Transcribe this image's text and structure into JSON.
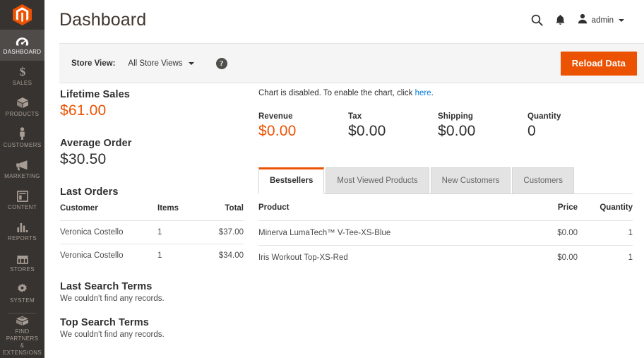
{
  "colors": {
    "accent_orange": "#eb5202",
    "sidebar_bg": "#373330",
    "sidebar_active_bg": "#4f4b48",
    "link_blue": "#007bdb",
    "panel_bg": "#f5f5f5"
  },
  "sidebar": {
    "logo_name": "magento-logo",
    "items": [
      {
        "label": "DASHBOARD",
        "icon": "dashboard-gauge-icon",
        "active": true
      },
      {
        "label": "SALES",
        "icon": "dollar-sign-icon",
        "active": false
      },
      {
        "label": "PRODUCTS",
        "icon": "box-icon",
        "active": false
      },
      {
        "label": "CUSTOMERS",
        "icon": "person-icon",
        "active": false
      },
      {
        "label": "MARKETING",
        "icon": "megaphone-icon",
        "active": false
      },
      {
        "label": "CONTENT",
        "icon": "layout-panel-icon",
        "active": false
      },
      {
        "label": "REPORTS",
        "icon": "bar-chart-icon",
        "active": false
      },
      {
        "label": "STORES",
        "icon": "storefront-icon",
        "active": false
      },
      {
        "label": "SYSTEM",
        "icon": "gear-icon",
        "active": false
      },
      {
        "label": "FIND PARTNERS\n& EXTENSIONS",
        "icon": "open-box-icon",
        "active": false
      }
    ],
    "partners_line1": "FIND PARTNERS",
    "partners_line2": "& EXTENSIONS"
  },
  "header": {
    "title": "Dashboard",
    "search_icon": "search-icon",
    "notifications_icon": "bell-icon",
    "avatar_icon": "user-avatar-icon",
    "admin_name": "admin"
  },
  "storebar": {
    "label": "Store View:",
    "selected": "All Store Views",
    "help_glyph": "?",
    "reload_label": "Reload Data"
  },
  "left": {
    "lifetime_sales_title": "Lifetime Sales",
    "lifetime_sales_value": "$61.00",
    "average_order_title": "Average Order",
    "average_order_value": "$30.50",
    "last_orders_title": "Last Orders",
    "last_orders_columns": [
      "Customer",
      "Items",
      "Total"
    ],
    "last_orders_rows": [
      {
        "customer": "Veronica Costello",
        "items": "1",
        "total": "$37.00"
      },
      {
        "customer": "Veronica Costello",
        "items": "1",
        "total": "$34.00"
      }
    ],
    "last_search_title": "Last Search Terms",
    "last_search_empty": "We couldn't find any records.",
    "top_search_title": "Top Search Terms",
    "top_search_empty": "We couldn't find any records."
  },
  "right": {
    "chart_note_prefix": "Chart is disabled. To enable the chart, click ",
    "chart_note_link": "here",
    "chart_note_suffix": ".",
    "totals": [
      {
        "label": "Revenue",
        "value": "$0.00",
        "accent": true
      },
      {
        "label": "Tax",
        "value": "$0.00",
        "accent": false
      },
      {
        "label": "Shipping",
        "value": "$0.00",
        "accent": false
      },
      {
        "label": "Quantity",
        "value": "0",
        "accent": false
      }
    ],
    "tabs": [
      {
        "label": "Bestsellers",
        "active": true
      },
      {
        "label": "Most Viewed Products",
        "active": false
      },
      {
        "label": "New Customers",
        "active": false
      },
      {
        "label": "Customers",
        "active": false
      }
    ],
    "bestsellers_columns": [
      "Product",
      "Price",
      "Quantity"
    ],
    "bestsellers_rows": [
      {
        "product": "Minerva LumaTech™ V-Tee-XS-Blue",
        "price": "$0.00",
        "quantity": "1"
      },
      {
        "product": "Iris Workout Top-XS-Red",
        "price": "$0.00",
        "quantity": "1"
      }
    ]
  }
}
